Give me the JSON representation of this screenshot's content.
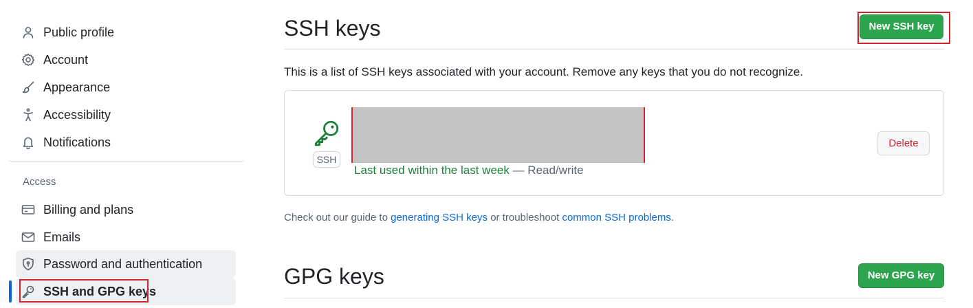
{
  "sidebar": {
    "items": [
      {
        "label": "Public profile",
        "icon": "person-icon"
      },
      {
        "label": "Account",
        "icon": "gear-icon"
      },
      {
        "label": "Appearance",
        "icon": "paintbrush-icon"
      },
      {
        "label": "Accessibility",
        "icon": "accessibility-icon"
      },
      {
        "label": "Notifications",
        "icon": "bell-icon"
      }
    ],
    "access_heading": "Access",
    "access_items": [
      {
        "label": "Billing and plans",
        "icon": "credit-card-icon"
      },
      {
        "label": "Emails",
        "icon": "mail-icon"
      },
      {
        "label": "Password and authentication",
        "icon": "shield-lock-icon"
      },
      {
        "label": "SSH and GPG keys",
        "icon": "key-icon",
        "selected": true
      }
    ]
  },
  "ssh": {
    "title": "SSH keys",
    "new_button": "New SSH key",
    "intro": "This is a list of SSH keys associated with your account. Remove any keys that you do not recognize.",
    "key": {
      "badge": "SSH",
      "last_used": "Last used within the last week",
      "access": " — Read/write",
      "delete_label": "Delete"
    },
    "guide": {
      "prefix": "Check out our guide to ",
      "link1": "generating SSH keys",
      "middle": " or troubleshoot ",
      "link2": "common SSH problems",
      "suffix": "."
    }
  },
  "gpg": {
    "title": "GPG keys",
    "new_button": "New GPG key"
  },
  "colors": {
    "accent_green": "#2da44e",
    "link_blue": "#0969da",
    "danger_red": "#d1242f",
    "selection_blue": "#0969da"
  }
}
